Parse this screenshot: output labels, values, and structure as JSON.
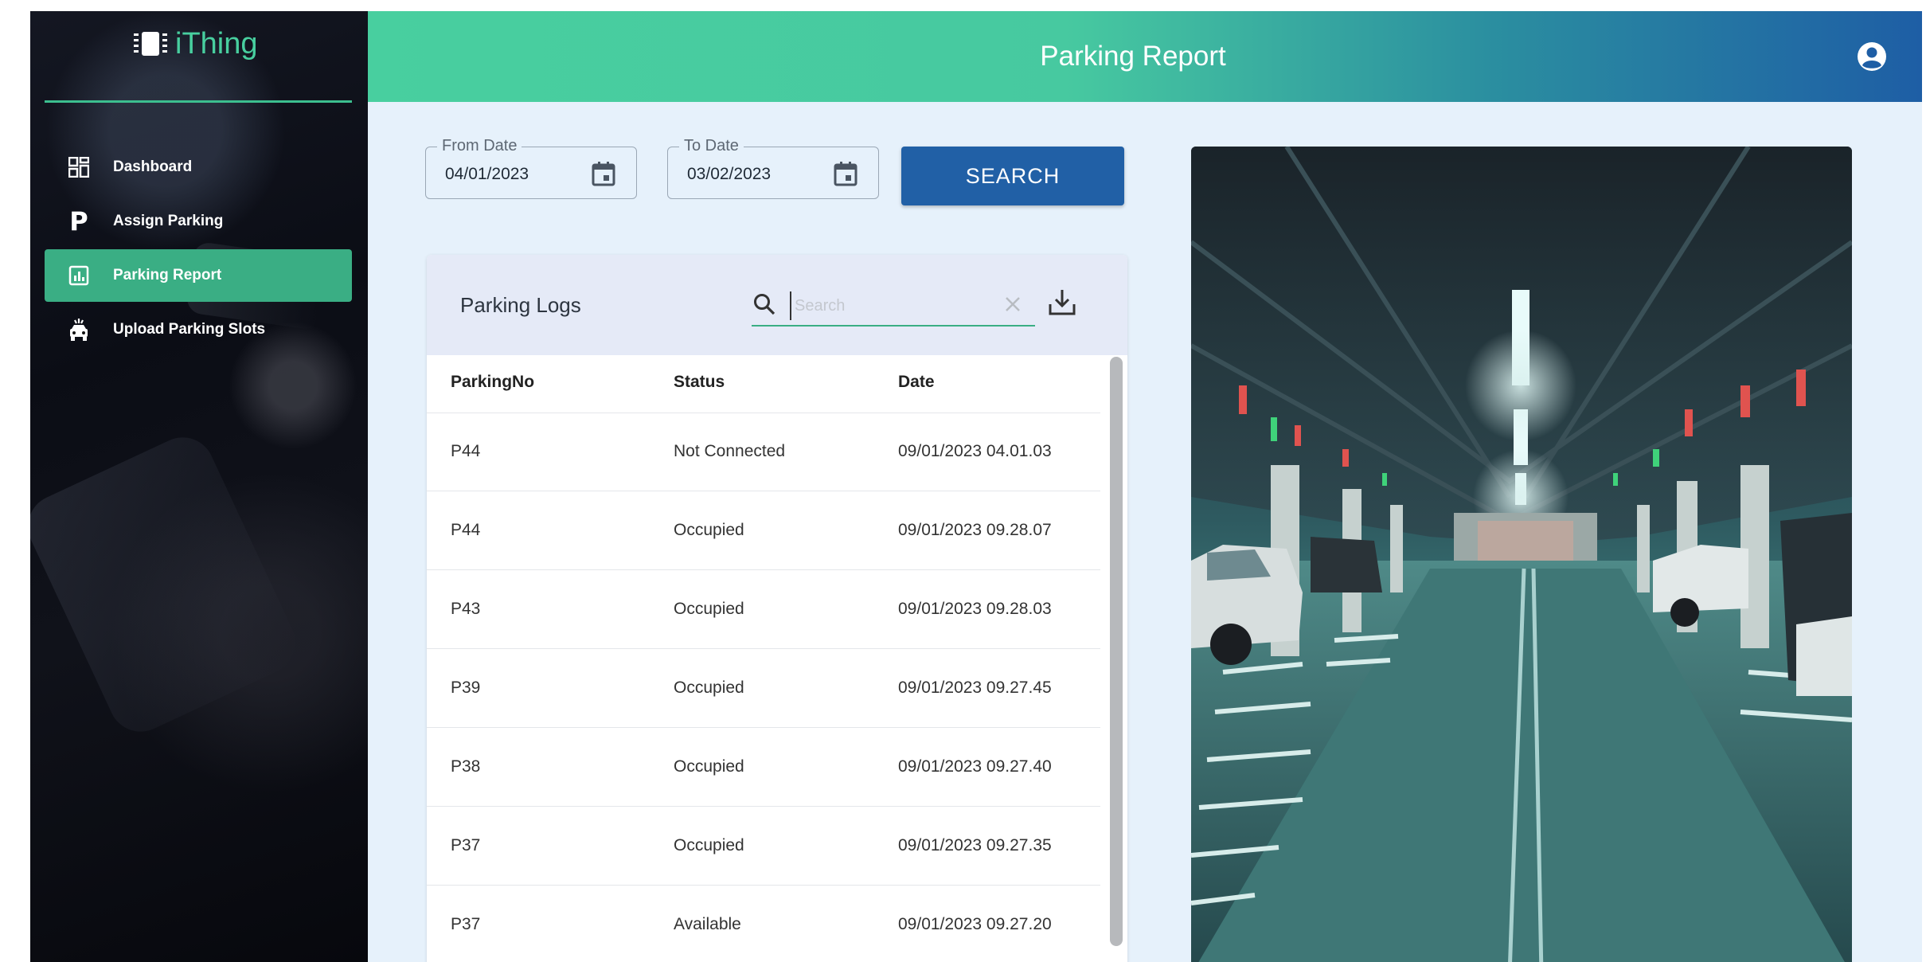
{
  "app": {
    "logo_text": "iThing"
  },
  "sidebar": {
    "items": [
      {
        "label": "Dashboard",
        "icon": "dashboard-icon",
        "active": false
      },
      {
        "label": "Assign Parking",
        "icon": "parking-p-icon",
        "active": false
      },
      {
        "label": "Parking Report",
        "icon": "report-chart-icon",
        "active": true
      },
      {
        "label": "Upload Parking Slots",
        "icon": "car-upload-icon",
        "active": false
      }
    ]
  },
  "header": {
    "title": "Parking Report",
    "account_icon": "account-circle-icon"
  },
  "filters": {
    "from_label": "From Date",
    "from_value": "04/01/2023",
    "to_label": "To Date",
    "to_value": "03/02/2023",
    "search_button": "SEARCH"
  },
  "logs": {
    "title": "Parking Logs",
    "search_placeholder": "Search",
    "columns": [
      "ParkingNo",
      "Status",
      "Date"
    ],
    "rows": [
      [
        "P44",
        "Not Connected",
        "09/01/2023 04.01.03"
      ],
      [
        "P44",
        "Occupied",
        "09/01/2023 09.28.07"
      ],
      [
        "P43",
        "Occupied",
        "09/01/2023 09.28.03"
      ],
      [
        "P39",
        "Occupied",
        "09/01/2023 09.27.45"
      ],
      [
        "P38",
        "Occupied",
        "09/01/2023 09.27.40"
      ],
      [
        "P37",
        "Occupied",
        "09/01/2023 09.27.35"
      ],
      [
        "P37",
        "Available",
        "09/01/2023 09.27.20"
      ]
    ]
  },
  "colors": {
    "accent_green": "#48cf9f",
    "active_nav": "#3aae84",
    "button_blue": "#2160a6",
    "page_bg": "#e6f1fb"
  }
}
